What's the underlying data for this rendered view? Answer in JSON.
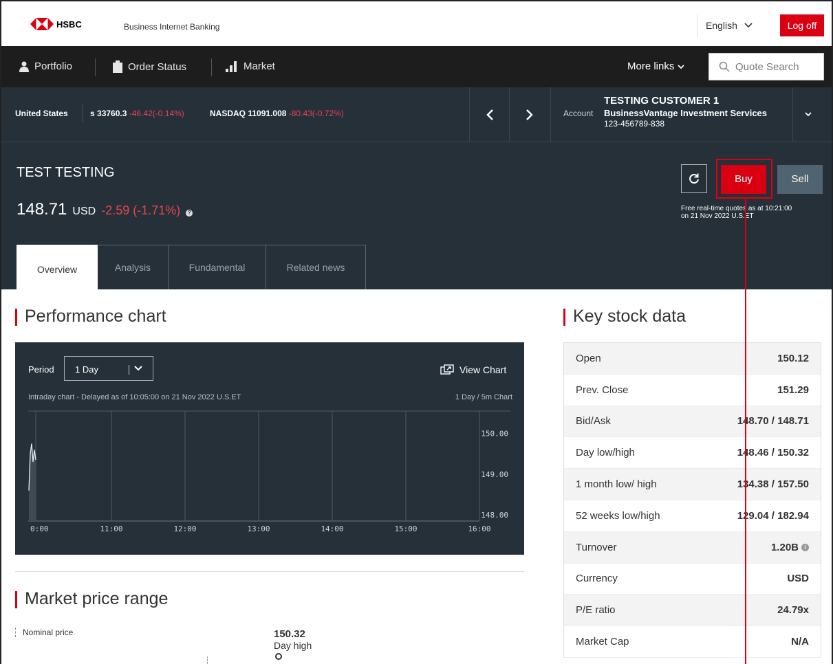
{
  "header": {
    "logo_text": "HSBC",
    "subtitle": "Business Internet Banking",
    "language": "English",
    "logoff_label": "Log off"
  },
  "nav": {
    "items": [
      {
        "label": "Portfolio",
        "icon": "person-icon"
      },
      {
        "label": "Order Status",
        "icon": "clipboard-icon"
      },
      {
        "label": "Market",
        "icon": "bar-chart-icon"
      }
    ],
    "more_links": "More links",
    "quote_search_placeholder": "Quote Search"
  },
  "ticker": {
    "region": "United States",
    "index1_name": "s",
    "index1_value": "33760.3",
    "index1_change": "-46.42(-0.14%)",
    "index2_name": "NASDAQ",
    "index2_value": "11091.008",
    "index2_change": "-80.43(-0.72%)"
  },
  "account": {
    "label": "Account",
    "customer": "TESTING CUSTOMER 1",
    "service": "BusinessVantage Investment Services",
    "number": "123-456789-838"
  },
  "stock": {
    "name": "TEST TESTING",
    "price": "148.71",
    "currency": "USD",
    "change": "-2.59 (-1.71%)",
    "buy_label": "Buy",
    "sell_label": "Sell",
    "realtime_note_line1": "Free real-time quotes as at 10:21:00",
    "realtime_note_line2": "on 21 Nov 2022 U.S.ET"
  },
  "tabs": [
    "Overview",
    "Analysis",
    "Fundamental",
    "Related news"
  ],
  "performance": {
    "title": "Performance chart",
    "period_label": "Period",
    "period_value": "1 Day",
    "view_chart": "View Chart",
    "intraday_note": "Intraday chart - Delayed as of 10:05:00 on 21 Nov 2022 U.S.ET",
    "chart_type": "1 Day / 5m Chart"
  },
  "chart_data": {
    "type": "area",
    "x_ticks": [
      "0:00",
      "11:00",
      "12:00",
      "13:00",
      "14:00",
      "15:00",
      "16:00"
    ],
    "y_ticks": [
      "150.00",
      "149.00",
      "148.00"
    ],
    "ylim": [
      147.85,
      150.55
    ],
    "series": [
      {
        "values": [
          148.6,
          149.5,
          149.75,
          149.3,
          149.6,
          149.35
        ]
      }
    ]
  },
  "market_range": {
    "title": "Market price range",
    "nominal_label": "Nominal price",
    "day_high_value": "150.32",
    "day_high_label": "Day high"
  },
  "key_stock": {
    "title": "Key stock data",
    "rows": [
      {
        "label": "Open",
        "value": "150.12"
      },
      {
        "label": "Prev. Close",
        "value": "151.29"
      },
      {
        "label": "Bid/Ask",
        "value": "148.70 / 148.71"
      },
      {
        "label": "Day low/high",
        "value": "148.46 / 150.32"
      },
      {
        "label": "1 month low/ high",
        "value": "134.38 / 157.50"
      },
      {
        "label": "52 weeks low/high",
        "value": "129.04 / 182.94"
      },
      {
        "label": "Turnover",
        "value": "1.20B"
      },
      {
        "label": "Currency",
        "value": "USD"
      },
      {
        "label": "P/E ratio",
        "value": "24.79x"
      },
      {
        "label": "Market Cap",
        "value": "N/A"
      }
    ]
  },
  "colors": {
    "accent_red": "#db0011",
    "dark_panel": "#253038",
    "nav_bg": "#1d1d1d",
    "negative": "#e8454f"
  }
}
